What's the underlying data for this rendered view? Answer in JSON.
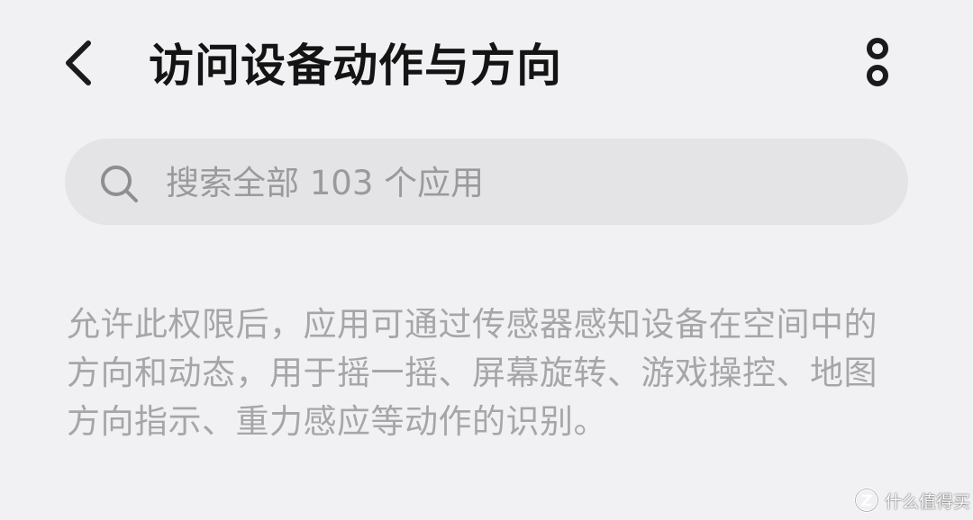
{
  "header": {
    "title": "访问设备动作与方向",
    "back_icon": "chevron-left-icon",
    "more_icon": "more-vertical-icon"
  },
  "search": {
    "icon": "search-icon",
    "placeholder": "搜索全部 103 个应用"
  },
  "description": {
    "text": "允许此权限后，应用可通过传感器感知设备在空间中的方向和动态，用于摇一摇、屏幕旋转、游戏操控、地图方向指示、重力感应等动作的识别。"
  },
  "watermark": {
    "logo_icon": "zhi-logo-icon",
    "text": "什么值得买"
  },
  "colors": {
    "background": "#f1f1f3",
    "search_background": "#e4e4e6",
    "title": "#141414",
    "placeholder": "#9a9a9c",
    "description": "#a6a6a8"
  }
}
